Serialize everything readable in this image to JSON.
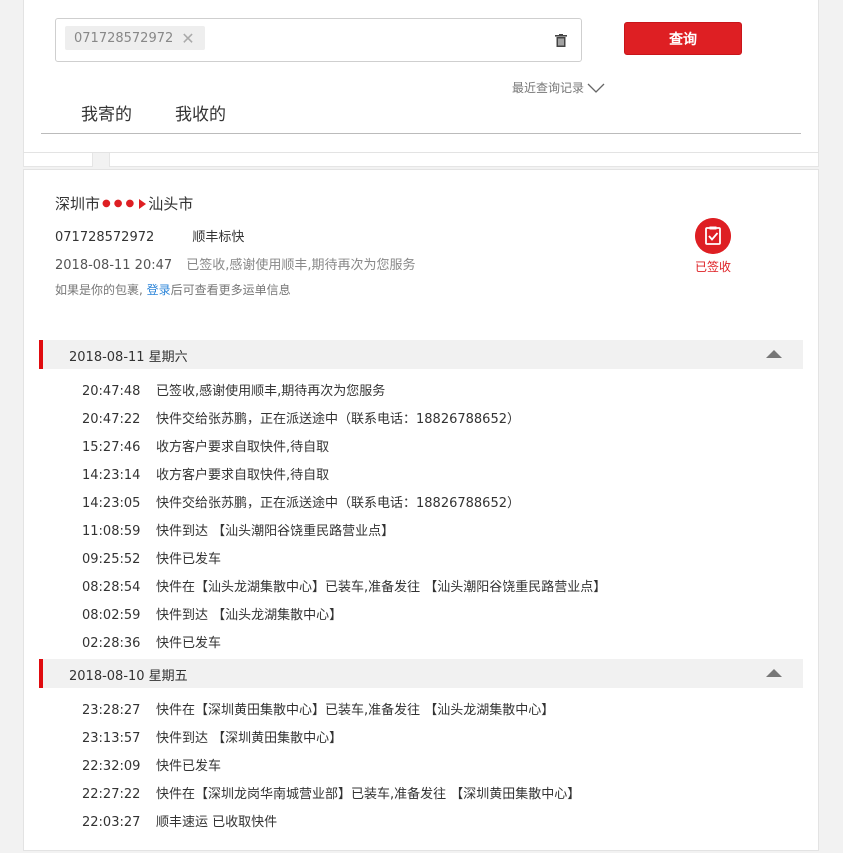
{
  "search": {
    "tag": "071728572972",
    "button": "查询",
    "recent": "最近查询记录"
  },
  "tabs": {
    "sent": "我寄的",
    "received": "我收的"
  },
  "summary": {
    "origin": "深圳市",
    "destination": "汕头市",
    "waybill": "071728572972",
    "service": "顺丰标快",
    "latest_time": "2018-08-11 20:47",
    "latest_status": "已签收,感谢使用顺丰,期待再次为您服务",
    "login_pre": "如果是你的包裹,",
    "login_link": "登录",
    "login_post": "后可查看更多运单信息",
    "badge": "已签收"
  },
  "days": [
    {
      "label": "2018-08-11 星期六",
      "rows": [
        {
          "time": "20:47:48",
          "text": "已签收,感谢使用顺丰,期待再次为您服务"
        },
        {
          "time": "20:47:22",
          "text": "快件交给张苏鹏，正在派送途中（联系电话：18826788652）"
        },
        {
          "time": "15:27:46",
          "text": "收方客户要求自取快件,待自取"
        },
        {
          "time": "14:23:14",
          "text": "收方客户要求自取快件,待自取"
        },
        {
          "time": "14:23:05",
          "text": "快件交给张苏鹏，正在派送途中（联系电话：18826788652）"
        },
        {
          "time": "11:08:59",
          "text": "快件到达 【汕头潮阳谷饶重民路营业点】"
        },
        {
          "time": "09:25:52",
          "text": "快件已发车"
        },
        {
          "time": "08:28:54",
          "text": "快件在【汕头龙湖集散中心】已装车,准备发往 【汕头潮阳谷饶重民路营业点】"
        },
        {
          "time": "08:02:59",
          "text": "快件到达 【汕头龙湖集散中心】"
        },
        {
          "time": "02:28:36",
          "text": "快件已发车"
        }
      ]
    },
    {
      "label": "2018-08-10 星期五",
      "rows": [
        {
          "time": "23:28:27",
          "text": "快件在【深圳黄田集散中心】已装车,准备发往 【汕头龙湖集散中心】"
        },
        {
          "time": "23:13:57",
          "text": "快件到达 【深圳黄田集散中心】"
        },
        {
          "time": "22:32:09",
          "text": "快件已发车"
        },
        {
          "time": "22:27:22",
          "text": "快件在【深圳龙岗华南城营业部】已装车,准备发往 【深圳黄田集散中心】"
        },
        {
          "time": "22:03:27",
          "text": "顺丰速运 已收取快件"
        }
      ]
    }
  ]
}
